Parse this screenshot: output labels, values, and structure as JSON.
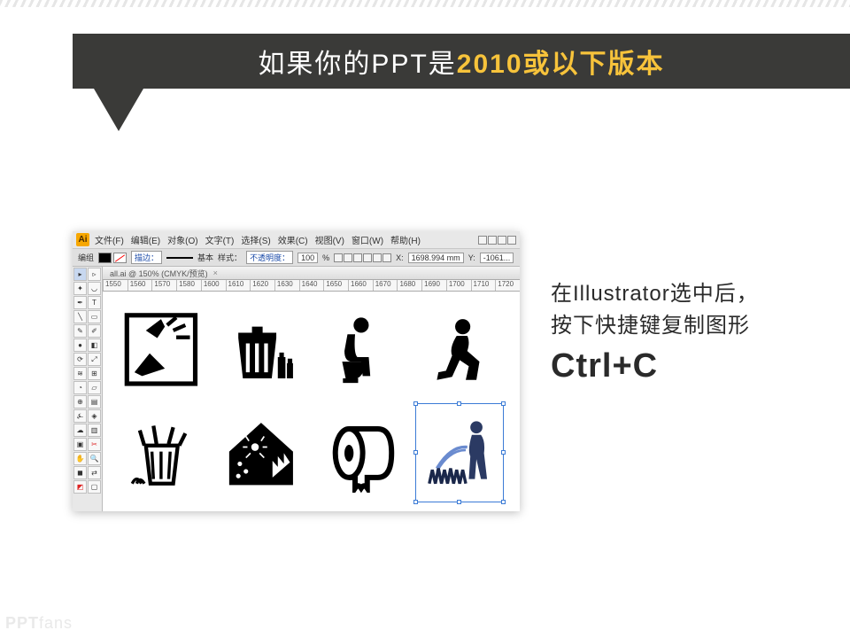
{
  "title": {
    "prefix": "如果你的PPT是",
    "highlight": "2010或以下版本"
  },
  "instruction": {
    "line1": "在Illustrator选中后，",
    "line2": "按下快捷键复制图形",
    "shortcut": "Ctrl+C"
  },
  "illustrator": {
    "menus": [
      "文件(F)",
      "编辑(E)",
      "对象(O)",
      "文字(T)",
      "选择(S)",
      "效果(C)",
      "视图(V)",
      "窗口(W)",
      "帮助(H)"
    ],
    "options": {
      "group_label": "编组",
      "stroke_label": "描边：",
      "basic_label": "基本",
      "style_label": "样式：",
      "opacity_label": "不透明度：",
      "opacity_value": "100",
      "percent": "%",
      "x_label": "X:",
      "x_value": "1698.994 mm",
      "y_label": "Y:",
      "y_value": "-1061..."
    },
    "tab": "all.ai @ 150% (CMYK/预览)",
    "ruler_marks": [
      "1550",
      "1560",
      "1570",
      "1580",
      "1600",
      "1610",
      "1620",
      "1630",
      "1640",
      "1650",
      "1660",
      "1670",
      "1680",
      "1690",
      "1700",
      "1710",
      "1720"
    ],
    "icons": {
      "r1c1": "shoe-hand-gesture-icon",
      "r1c2": "trashcan-bottles-icon",
      "r1c3": "toilet-sitting-icon",
      "r1c4": "squatting-person-icon",
      "r2c1": "trashcan-banana-peel-icon",
      "r2c2": "house-spider-tree-icon",
      "r2c3": "toilet-paper-roll-icon",
      "r2c4": "person-watering-grass-icon"
    }
  },
  "watermark": {
    "brand": "PPT",
    "suffix": "Fans"
  }
}
